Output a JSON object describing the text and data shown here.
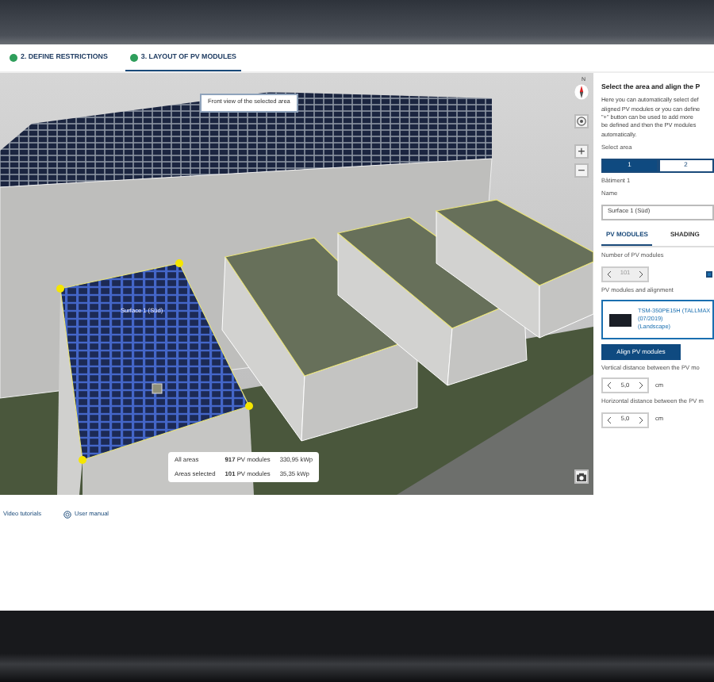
{
  "tabs": [
    {
      "label": "2. DEFINE RESTRICTIONS",
      "done": true,
      "selected": false
    },
    {
      "label": "3. LAYOUT OF PV MODULES",
      "done": true,
      "selected": true
    }
  ],
  "view": {
    "tooltip": "Front view of the selected area",
    "compass_label": "N",
    "surface_label": "Surface 1 (Süd)",
    "zoom_buttons": [
      "+",
      "−"
    ],
    "stats": [
      {
        "label": "All areas",
        "modules": "917",
        "modules_unit": "PV modules",
        "power": "330,95 kWp"
      },
      {
        "label": "Areas selected",
        "modules": "101",
        "modules_unit": "PV modules",
        "power": "35,35 kWp"
      }
    ]
  },
  "panel": {
    "title": "Select the area and align the P",
    "description_lines": [
      "Here you can automatically select def",
      "aligned PV modules or you can define",
      "\"+\" button can be used to add more",
      "be defined and then the PV modules",
      "automatically."
    ],
    "select_area_label": "Select area",
    "areas": [
      {
        "label": "1",
        "selected": true
      },
      {
        "label": "2",
        "selected": false
      }
    ],
    "building": "Bâtiment 1",
    "name_label": "Name",
    "name_value": "Surface 1 (Süd)",
    "tabs": [
      {
        "label": "PV MODULES",
        "selected": true
      },
      {
        "label": "SHADING",
        "selected": false
      }
    ],
    "count_label": "Number of PV modules",
    "count_value": "101",
    "count_disabled": true,
    "count_checked": true,
    "alignment_label": "PV modules and alignment",
    "module_lines": [
      "TSM-350PE15H (TALLMAX",
      "(07/2019)",
      "(Landscape)"
    ],
    "align_button": "Align PV modules",
    "distances": [
      {
        "label": "Vertical distance between the PV mo",
        "value": "5,0",
        "unit": "cm"
      },
      {
        "label": "Horizontal distance between the PV m",
        "value": "5,0",
        "unit": "cm"
      }
    ]
  },
  "footer_links": [
    {
      "label": "Video tutorials",
      "icon": false
    },
    {
      "label": "User manual",
      "icon": true
    }
  ]
}
